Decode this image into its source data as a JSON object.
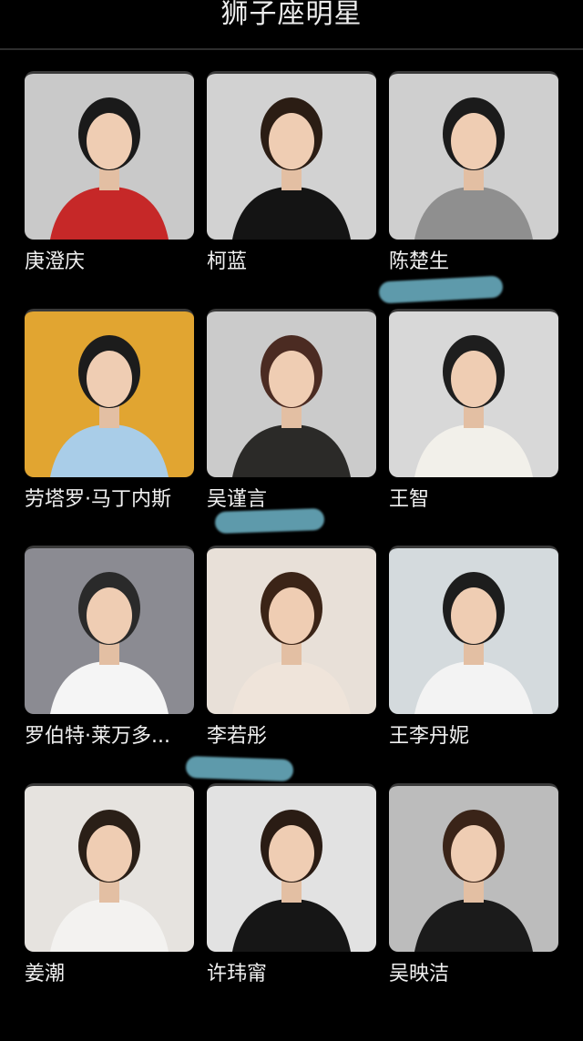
{
  "header": {
    "title": "狮子座明星"
  },
  "celebrities": [
    {
      "name": "庚澄庆",
      "bg": "#c9c9c9",
      "shirt": "#c62828",
      "hair": "#1a1a1a"
    },
    {
      "name": "柯蓝",
      "bg": "#d2d2d2",
      "shirt": "#141414",
      "hair": "#2b1d14"
    },
    {
      "name": "陈楚生",
      "bg": "#cfcfcf",
      "shirt": "#8f8f8f",
      "hair": "#1b1b1b"
    },
    {
      "name": "劳塔罗·马丁内斯",
      "bg": "#e1a531",
      "shirt": "#a9cde8",
      "hair": "#1c1c1c"
    },
    {
      "name": "吴谨言",
      "bg": "#cbcbcb",
      "shirt": "#2b2a28",
      "hair": "#4b2b22"
    },
    {
      "name": "王智",
      "bg": "#d8d8d8",
      "shirt": "#f2f0ea",
      "hair": "#1e1e1e"
    },
    {
      "name": "罗伯特·莱万多...",
      "bg": "#8b8b92",
      "shirt": "#f5f5f5",
      "hair": "#2a2a2a"
    },
    {
      "name": "李若彤",
      "bg": "#e8e0d8",
      "shirt": "#efe4da",
      "hair": "#3b2417"
    },
    {
      "name": "王李丹妮",
      "bg": "#d4dadd",
      "shirt": "#f3f3f3",
      "hair": "#1d1d1d"
    },
    {
      "name": "姜潮",
      "bg": "#e6e3df",
      "shirt": "#f3f2f0",
      "hair": "#2a1f17"
    },
    {
      "name": "许玮甯",
      "bg": "#e2e2e2",
      "shirt": "#161616",
      "hair": "#2a1c14"
    },
    {
      "name": "吴映洁",
      "bg": "#bcbcbc",
      "shirt": "#1b1b1b",
      "hair": "#3a2418"
    }
  ],
  "colors": {
    "background": "#000000",
    "redaction": "#6fb6c9"
  }
}
